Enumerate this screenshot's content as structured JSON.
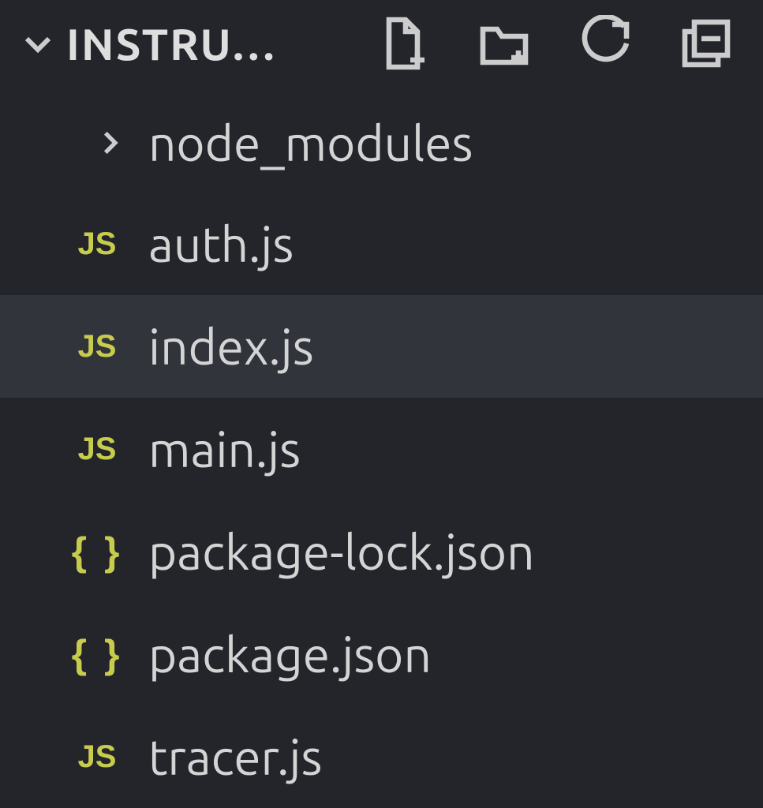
{
  "project": {
    "title": "INSTRU…"
  },
  "actions": {
    "newFile": "New File",
    "newFolder": "New Folder",
    "refresh": "Refresh Explorer",
    "collapse": "Collapse Folders"
  },
  "tree": {
    "folder": {
      "name": "node_modules",
      "expanded": false
    },
    "files": [
      {
        "name": "auth.js",
        "iconType": "js",
        "iconText": "JS",
        "selected": false
      },
      {
        "name": "index.js",
        "iconType": "js",
        "iconText": "JS",
        "selected": true
      },
      {
        "name": "main.js",
        "iconType": "js",
        "iconText": "JS",
        "selected": false
      },
      {
        "name": "package-lock.json",
        "iconType": "json",
        "iconText": "{ }",
        "selected": false
      },
      {
        "name": "package.json",
        "iconType": "json",
        "iconText": "{ }",
        "selected": false
      },
      {
        "name": "tracer.js",
        "iconType": "js",
        "iconText": "JS",
        "selected": false
      }
    ]
  }
}
